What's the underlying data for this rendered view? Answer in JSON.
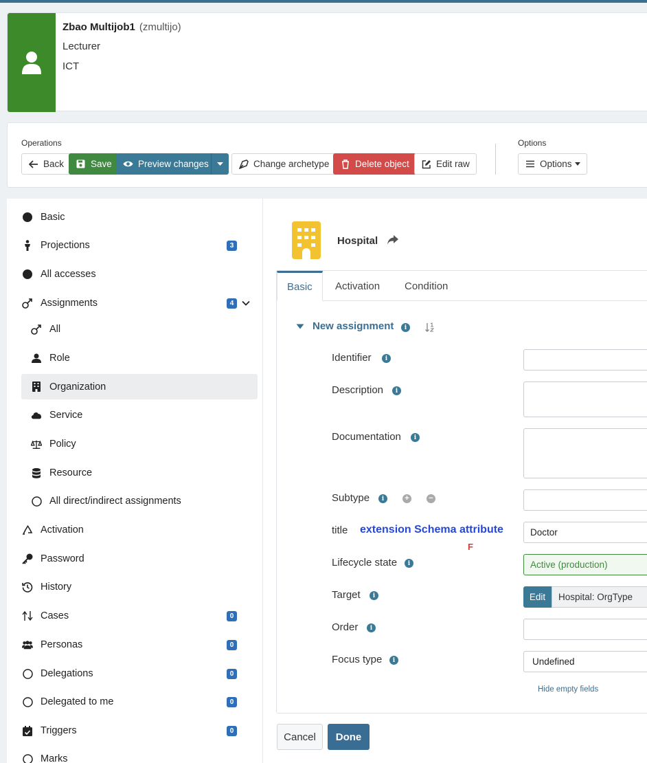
{
  "header": {
    "name": "Zbao Multijob1",
    "login": "(zmultijo)",
    "line1": "Lecturer",
    "line2": "ICT"
  },
  "operations": {
    "label": "Operations",
    "back": "Back",
    "save": "Save",
    "preview": "Preview changes",
    "change_archetype": "Change archetype",
    "delete": "Delete object",
    "edit_raw": "Edit raw",
    "options_label": "Options",
    "options_btn": "Options"
  },
  "sidebar": {
    "items": [
      {
        "label": "Basic"
      },
      {
        "label": "Projections",
        "badge": "3"
      },
      {
        "label": "All accesses"
      },
      {
        "label": "Assignments",
        "badge": "4"
      },
      {
        "label": "All"
      },
      {
        "label": "Role"
      },
      {
        "label": "Organization"
      },
      {
        "label": "Service"
      },
      {
        "label": "Policy"
      },
      {
        "label": "Resource"
      },
      {
        "label": "All direct/indirect assignments"
      },
      {
        "label": "Activation"
      },
      {
        "label": "Password"
      },
      {
        "label": "History"
      },
      {
        "label": "Cases",
        "badge": "0"
      },
      {
        "label": "Personas",
        "badge": "0"
      },
      {
        "label": "Delegations",
        "badge": "0"
      },
      {
        "label": "Delegated to me",
        "badge": "0"
      },
      {
        "label": "Triggers",
        "badge": "0"
      },
      {
        "label": "Marks"
      }
    ]
  },
  "main": {
    "title": "Hospital",
    "tabs": [
      {
        "label": "Basic"
      },
      {
        "label": "Activation"
      },
      {
        "label": "Condition"
      }
    ],
    "section_title": "New assignment",
    "fields": {
      "identifier": "Identifier",
      "description": "Description",
      "documentation": "Documentation",
      "subtype": "Subtype",
      "title": "title",
      "title_value": "Doctor",
      "lifecycle": "Lifecycle state",
      "lifecycle_value": "Active (production)",
      "target": "Target",
      "target_edit": "Edit",
      "target_value": "Hospital: OrgType",
      "order": "Order",
      "focus_type": "Focus type",
      "focus_type_value": "Undefined"
    },
    "annotation": "extension Schema attribute",
    "annotation_mark": "F",
    "hide_empty": "Hide empty fields",
    "cancel": "Cancel",
    "done": "Done"
  }
}
